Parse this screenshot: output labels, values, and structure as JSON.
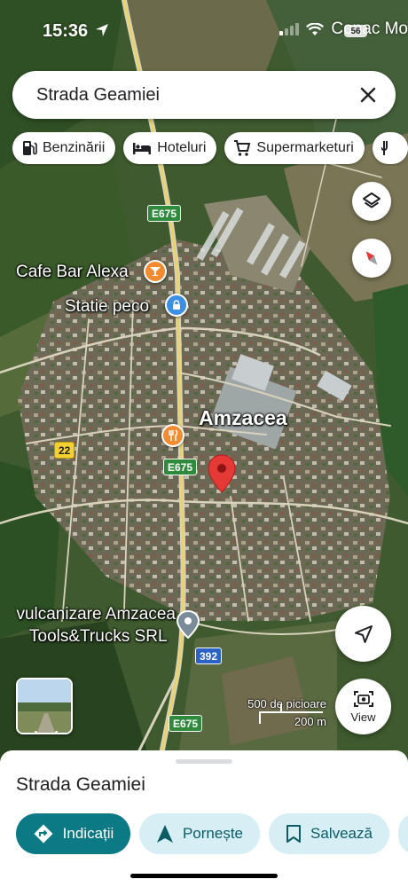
{
  "status_bar": {
    "time": "15:36",
    "carrier_text": "Conac Mo",
    "battery_level": "56"
  },
  "search": {
    "query": "Strada Geamiei"
  },
  "chips": [
    {
      "label": "Benzinării",
      "icon": "gas-station-icon"
    },
    {
      "label": "Hoteluri",
      "icon": "bed-icon"
    },
    {
      "label": "Supermarketuri",
      "icon": "shopping-cart-icon"
    }
  ],
  "map": {
    "town": "Amzacea",
    "pois": [
      {
        "name": "Cafe Bar Alexa",
        "icon": "cocktail-icon",
        "color": "#f28b30"
      },
      {
        "name": "Statie peco",
        "icon": "fuel-lock-icon",
        "color": "#3d8fe6"
      },
      {
        "name": "restaurant",
        "icon": "fork-knife-icon",
        "color": "#f28b30"
      },
      {
        "name": "vulcanizare Amzacea\nTools&Trucks SRL",
        "icon": "pin-icon",
        "color": "#7a8b99"
      }
    ],
    "poi_label_1": "vulcanizare Amzacea",
    "poi_label_2": "Tools&Trucks SRL",
    "road_shields": [
      {
        "label": "E675",
        "color": "#2e8b3c"
      },
      {
        "label": "E675",
        "color": "#2e8b3c"
      },
      {
        "label": "22",
        "color": "#f4d132"
      },
      {
        "label": "392",
        "color": "#2a62c5"
      },
      {
        "label": "E675",
        "color": "#2e8b3c"
      }
    ],
    "selected_pin_color": "#e53935"
  },
  "scale": {
    "imperial": "500 de picioare",
    "metric": "200 m"
  },
  "view_button": {
    "label": "View"
  },
  "sheet": {
    "place_name": "Strada Geamiei",
    "actions": [
      {
        "label": "Indicații",
        "icon": "directions-icon"
      },
      {
        "label": "Pornește",
        "icon": "navigation-arrow-icon"
      },
      {
        "label": "Salvează",
        "icon": "bookmark-icon"
      }
    ]
  },
  "colors": {
    "primary_action": "#0b7a84",
    "secondary_action": "#d6eef4"
  }
}
